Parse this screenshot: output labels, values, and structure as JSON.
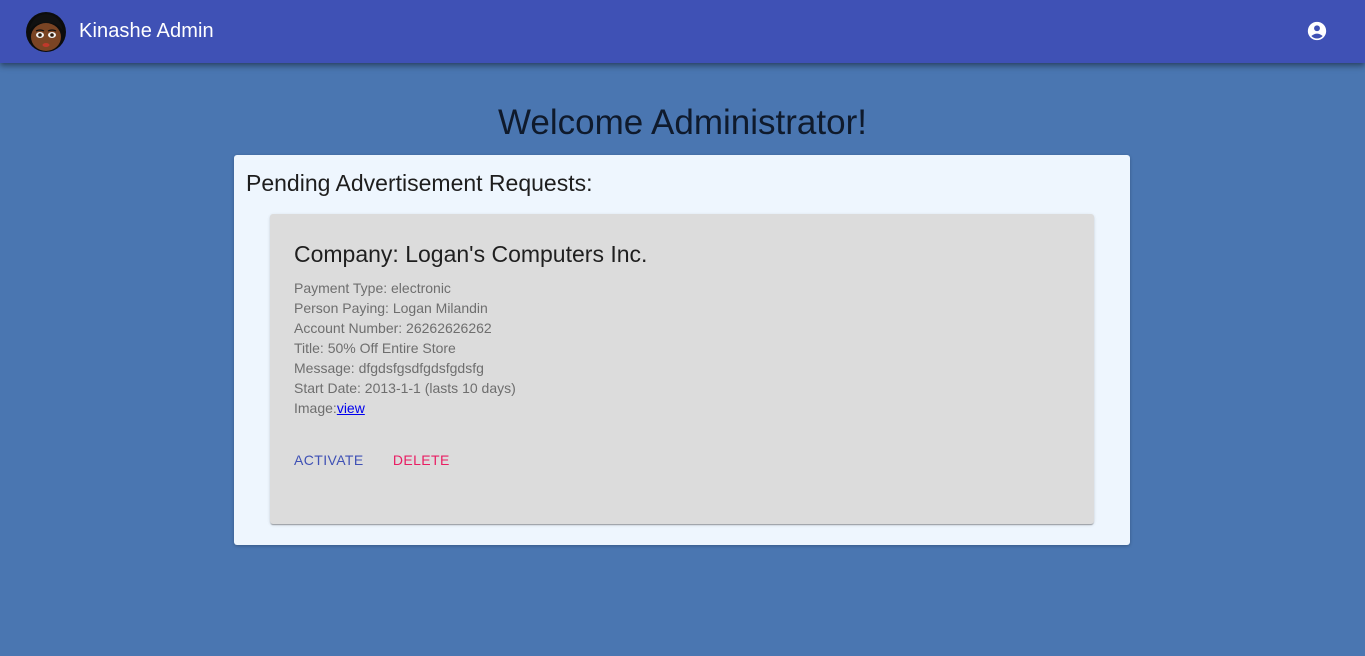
{
  "header": {
    "brand": "Kinashe Admin",
    "avatar_icon": "cartoon-face-avatar-icon",
    "account_icon": "account-circle-icon"
  },
  "welcome": "Welcome Administrator!",
  "pending": {
    "title": "Pending Advertisement Requests:",
    "requests": [
      {
        "company": "Company: Logan's Computers Inc.",
        "payment_type": "Payment Type: electronic",
        "person_paying": "Person Paying: Logan Milandin",
        "account_number": "Account Number: 26262626262",
        "title": "Title: 50% Off Entire Store",
        "message": "Message: dfgdsfgsdfgdsfgdsfg",
        "start_date": "Start Date: 2013-1-1 (lasts 10 days)",
        "image_label": "Image:",
        "image_link": "view",
        "activate_label": "Activate",
        "delete_label": "Delete"
      }
    ]
  },
  "colors": {
    "appbar": "#3f51b5",
    "background": "#4a76b1",
    "panel": "#eef6fe",
    "card": "#dcdcdc",
    "activate": "#3f51b5",
    "delete": "#e91e63"
  }
}
